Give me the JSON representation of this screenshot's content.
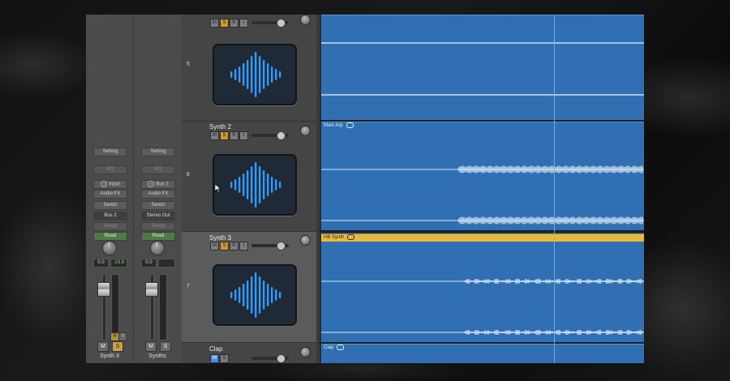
{
  "window": {
    "background": "marble-dark"
  },
  "colors": {
    "region": "#2f6fb2",
    "region_selected_header": "#e7b93c",
    "solo": "#c89a35",
    "waveform_icon": "#2e9bff",
    "playhead": "#d7a15a"
  },
  "mixer": {
    "strips": [
      {
        "name": "Synth 3",
        "setting": "Setting",
        "eq": "EQ",
        "eq_label": "",
        "input": "Input",
        "audio_fx": "Audio FX",
        "sends": "Sends",
        "output": "Bus 2",
        "group": "Group",
        "automation": "Read",
        "pan_value": "0.0",
        "level_value": "-23.8",
        "buttons": {
          "mute": "M",
          "solo": "S",
          "record": "R",
          "input_monitor": "I"
        }
      },
      {
        "name": "Synths",
        "setting": "Setting",
        "eq": "EQ",
        "input": "Bus 2",
        "audio_fx": "Audio FX",
        "sends": "Sends",
        "output": "Stereo Out",
        "group": "Group",
        "automation": "Read",
        "pan_value": "0.0",
        "level_value": "",
        "buttons": {
          "mute": "M",
          "solo": "S"
        }
      }
    ]
  },
  "tracks": [
    {
      "number": "5",
      "name": "",
      "icon": "waveform-icon",
      "buttons": {
        "mute": "M",
        "solo": "S",
        "record": "R",
        "input": "I"
      }
    },
    {
      "number": "6",
      "name": "Synth 2",
      "icon": "waveform-icon",
      "buttons": {
        "mute": "M",
        "solo": "S",
        "record": "R",
        "input": "I"
      }
    },
    {
      "number": "7",
      "name": "Synth 3",
      "icon": "waveform-icon",
      "selected": true,
      "buttons": {
        "mute": "M",
        "solo": "S",
        "record": "R",
        "input": "I"
      }
    },
    {
      "number": "",
      "name": "Clap",
      "buttons": {
        "mute": "M",
        "solo": "S"
      }
    }
  ],
  "regions": [
    {
      "lane": 0,
      "name": ""
    },
    {
      "lane": 1,
      "name": "Main Arp"
    },
    {
      "lane": 2,
      "name": "HB Synth",
      "selected": true
    },
    {
      "lane": 3,
      "name": "Clap"
    }
  ]
}
